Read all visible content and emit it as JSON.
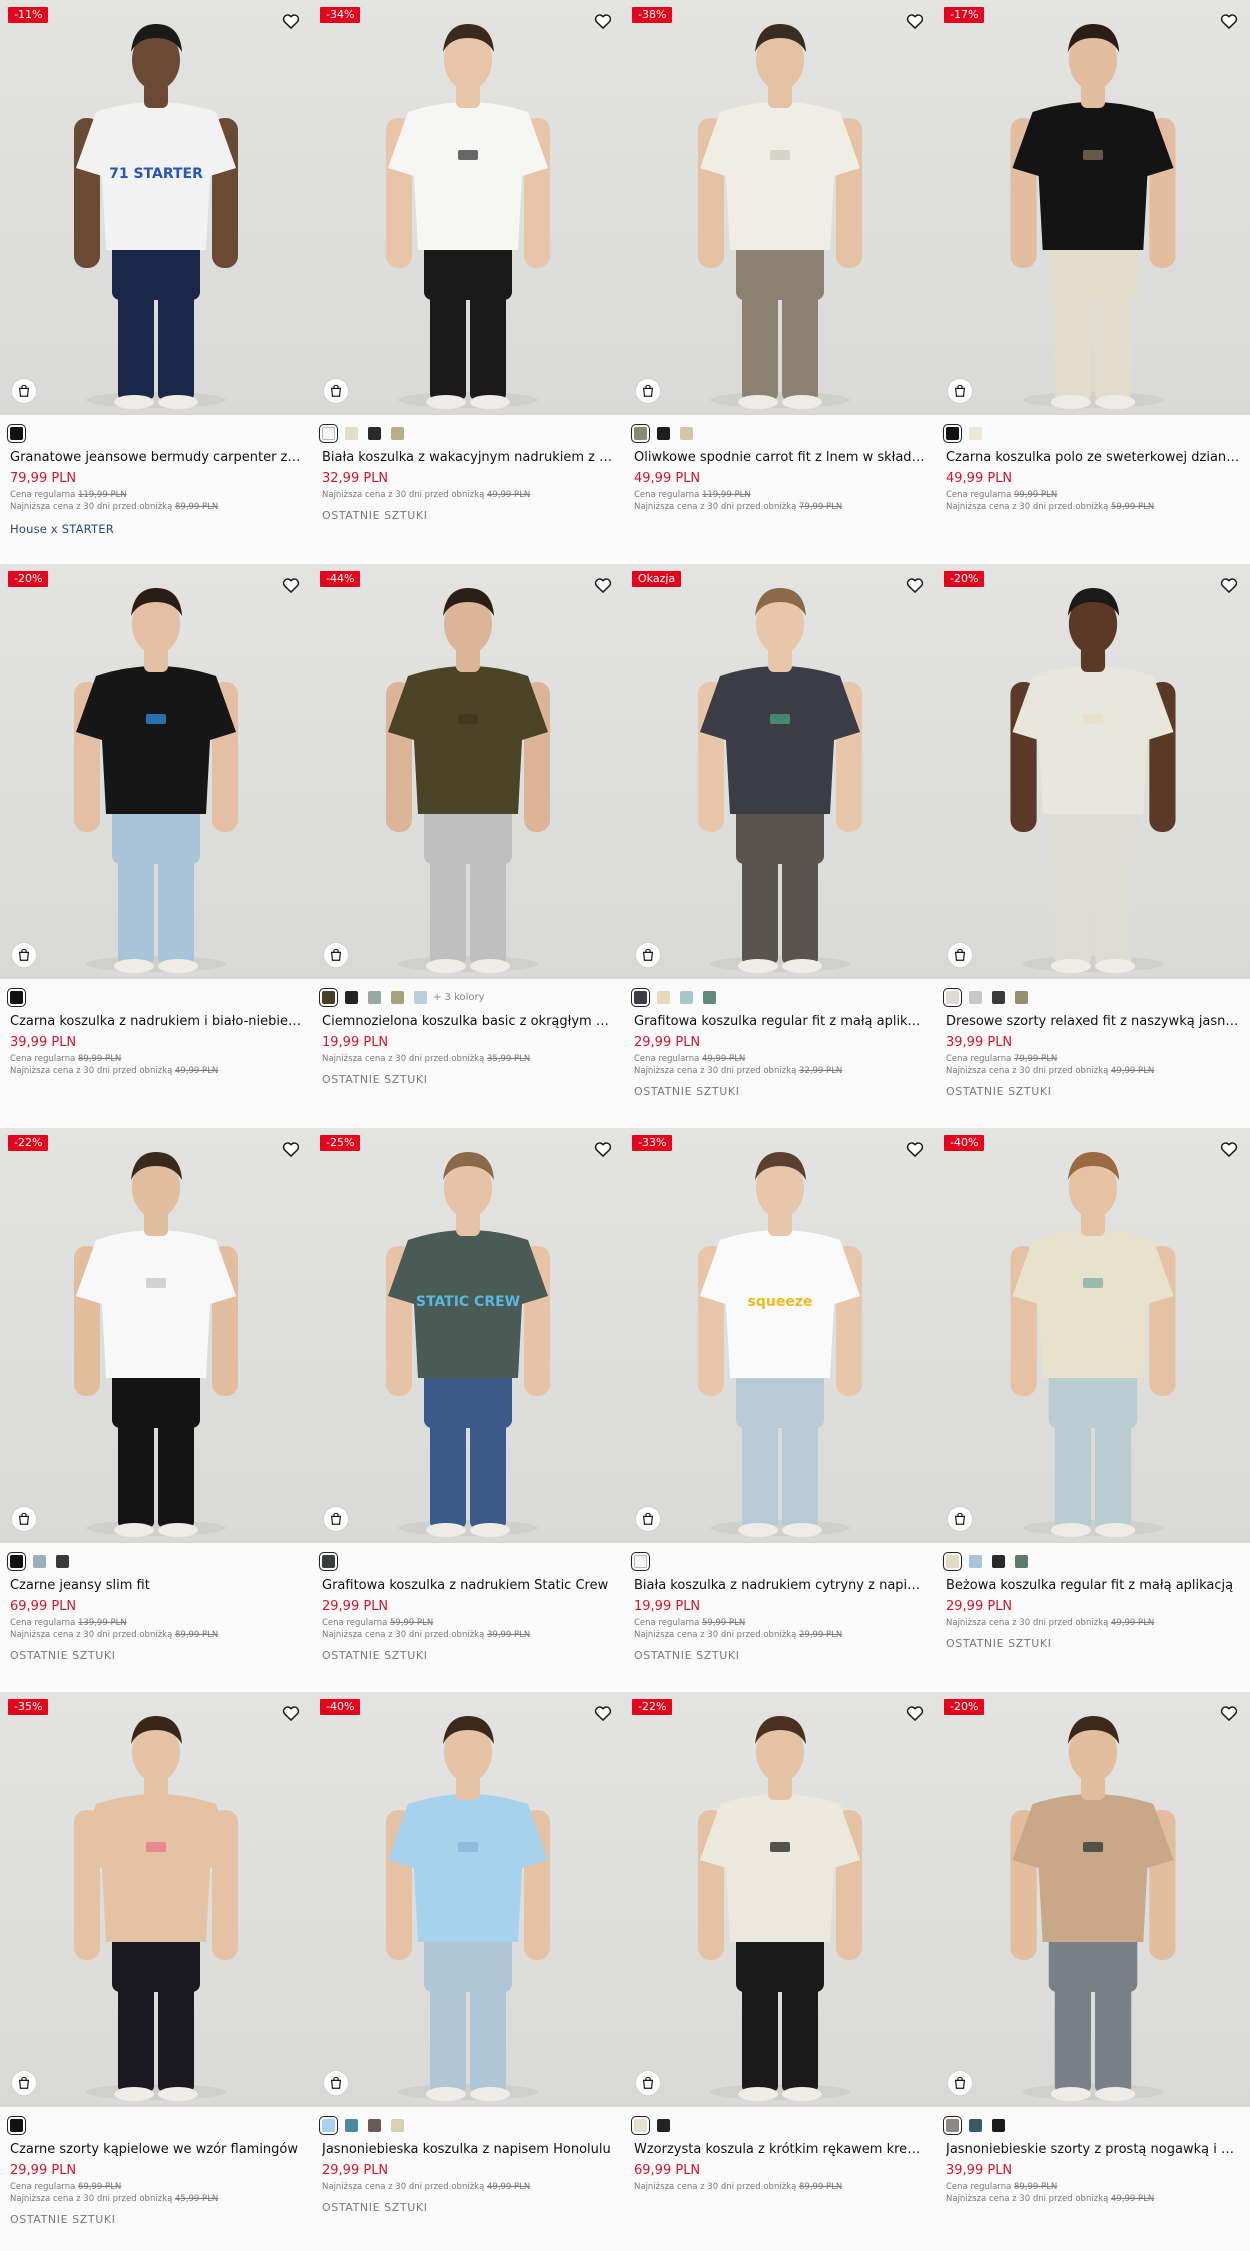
{
  "ui": {
    "regular_label": "Cena regularna",
    "lowest_label": "Najniższa cena z 30 dni przed obniżką",
    "currency_colors": {
      "price": "#d8142b",
      "badge": "#e3051b"
    }
  },
  "products": [
    {
      "badge": "-11%",
      "name": "Granatowe jeansowe bermudy carpenter z h…",
      "price": "79,99 PLN",
      "regular": "119,99 PLN",
      "lowest": "89,99 PLN",
      "tag": "",
      "collab": "House x STARTER",
      "swatches": [
        "#111111"
      ],
      "more": "",
      "look": {
        "top": "#f2f2f2",
        "bottom": "#1b2748",
        "skin": "#6b4a33",
        "hair": "#1a1a1a",
        "accent": "#2b55b5",
        "print": "71 STARTER"
      }
    },
    {
      "badge": "-34%",
      "name": "Biała koszulka z wakacyjnym nadrukiem z pr…",
      "price": "32,99 PLN",
      "regular": "",
      "lowest": "49,99 PLN",
      "tag": "OSTATNIE SZTUKI",
      "collab": "",
      "swatches": [
        "#f4f4f4",
        "#e2dcc8",
        "#2a2a2a",
        "#b5b08a"
      ],
      "more": "",
      "look": {
        "top": "#f6f6f4",
        "bottom": "#1a1a1a",
        "skin": "#e8c4a8",
        "hair": "#3a2a1e",
        "accent": "#444444",
        "print": ""
      }
    },
    {
      "badge": "-38%",
      "name": "Oliwkowe spodnie carrot fit z lnem w składz…",
      "price": "49,99 PLN",
      "regular": "119,99 PLN",
      "lowest": "79,99 PLN",
      "tag": "",
      "collab": "",
      "swatches": [
        "#8a8a72",
        "#1e1e1e",
        "#d2c8a8"
      ],
      "more": "",
      "look": {
        "top": "#f0eee4",
        "bottom": "#8d8172",
        "skin": "#e6c2a4",
        "hair": "#3b2c22",
        "accent": "#d0ccc0",
        "print": ""
      }
    },
    {
      "badge": "-17%",
      "name": "Czarna koszulka polo ze sweterkowej dzianiny",
      "price": "49,99 PLN",
      "regular": "99,99 PLN",
      "lowest": "59,99 PLN",
      "tag": "",
      "collab": "",
      "swatches": [
        "#111111",
        "#ece8d8"
      ],
      "more": "",
      "look": {
        "top": "#141414",
        "bottom": "#e4dccb",
        "skin": "#e2bda0",
        "hair": "#2b1e16",
        "accent": "#7a6a55",
        "print": ""
      }
    },
    {
      "badge": "-20%",
      "name": "Czarna koszulka z nadrukiem i biało-niebiesk…",
      "price": "39,99 PLN",
      "regular": "89,99 PLN",
      "lowest": "49,99 PLN",
      "tag": "",
      "collab": "",
      "swatches": [
        "#111111"
      ],
      "more": "",
      "look": {
        "top": "#161616",
        "bottom": "#a9c3d8",
        "skin": "#e4bfa3",
        "hair": "#2a1d15",
        "accent": "#2a8ad6",
        "print": ""
      }
    },
    {
      "badge": "-44%",
      "name": "Ciemnozielona koszulka basic z okrągłym de…",
      "price": "19,99 PLN",
      "regular": "",
      "lowest": "35,99 PLN",
      "tag": "OSTATNIE SZTUKI",
      "collab": "",
      "swatches": [
        "#4a3e24",
        "#222222",
        "#9aa8a4",
        "#a8a27c",
        "#b8cfe0"
      ],
      "more": "+ 3 kolory",
      "look": {
        "top": "#4b4326",
        "bottom": "#bfbfbf",
        "skin": "#dcb497",
        "hair": "#2a1f17",
        "accent": "#3f3820",
        "print": ""
      }
    },
    {
      "badge": "Okazja",
      "name": "Grafitowa koszulka regular fit z małą aplikacją",
      "price": "29,99 PLN",
      "regular": "49,99 PLN",
      "lowest": "32,99 PLN",
      "tag": "OSTATNIE SZTUKI",
      "collab": "",
      "swatches": [
        "#3c3c44",
        "#e8d8bc",
        "#a8c6cc",
        "#5d8a7a"
      ],
      "more": "",
      "look": {
        "top": "#3b3c45",
        "bottom": "#5a5450",
        "skin": "#e8c6aa",
        "hair": "#8a6a48",
        "accent": "#4a9a7a",
        "print": ""
      }
    },
    {
      "badge": "-20%",
      "name": "Dresowe szorty relaxed fit z naszywką jasnos…",
      "price": "39,99 PLN",
      "regular": "79,99 PLN",
      "lowest": "49,99 PLN",
      "tag": "OSTATNIE SZTUKI",
      "collab": "",
      "swatches": [
        "#dcdcd0",
        "#c8c8c8",
        "#3a3a3a",
        "#9a8c70"
      ],
      "more": "",
      "look": {
        "top": "#e6e6dc",
        "bottom": "#dcdcd4",
        "skin": "#5a3a26",
        "hair": "#1a1a1a",
        "accent": "#e8e0c4",
        "print": ""
      }
    },
    {
      "badge": "-22%",
      "name": "Czarne jeansy slim fit",
      "price": "69,99 PLN",
      "regular": "139,99 PLN",
      "lowest": "89,99 PLN",
      "tag": "OSTATNIE SZTUKI",
      "collab": "",
      "swatches": [
        "#111111",
        "#9ab0b8",
        "#3a3a3a"
      ],
      "more": "",
      "look": {
        "top": "#f8f8f8",
        "bottom": "#141414",
        "skin": "#e2bd9e",
        "hair": "#3a2a1e",
        "accent": "#c8c8c8",
        "print": ""
      }
    },
    {
      "badge": "-25%",
      "name": "Grafitowa koszulka z nadrukiem Static Crew",
      "price": "29,99 PLN",
      "regular": "59,99 PLN",
      "lowest": "39,99 PLN",
      "tag": "OSTATNIE SZTUKI",
      "collab": "",
      "swatches": [
        "#3a3f3c"
      ],
      "more": "",
      "look": {
        "top": "#4a5a54",
        "bottom": "#3b5a8a",
        "skin": "#e6c3a6",
        "hair": "#8a6a4a",
        "accent": "#5ab8e0",
        "print": "STATIC CREW"
      }
    },
    {
      "badge": "-33%",
      "name": "Biała koszulka z nadrukiem cytryny z napise…",
      "price": "19,99 PLN",
      "regular": "59,99 PLN",
      "lowest": "29,99 PLN",
      "tag": "OSTATNIE SZTUKI",
      "collab": "",
      "swatches": [
        "#f4f4f4"
      ],
      "more": "",
      "look": {
        "top": "#fafafa",
        "bottom": "#b8cad6",
        "skin": "#e8c6aa",
        "hair": "#5a4030",
        "accent": "#f2b81e",
        "print": "squeeze"
      }
    },
    {
      "badge": "-40%",
      "name": "Beżowa koszulka regular fit z małą aplikacją",
      "price": "29,99 PLN",
      "regular": "",
      "lowest": "49,99 PLN",
      "tag": "OSTATNIE SZTUKI",
      "collab": "",
      "swatches": [
        "#e4dcc0",
        "#a8c4d8",
        "#2a2a2a",
        "#5a7a6a"
      ],
      "more": "",
      "look": {
        "top": "#e8e2cc",
        "bottom": "#b9ccd2",
        "skin": "#e6c2a4",
        "hair": "#9a6a40",
        "accent": "#88b0a8",
        "print": ""
      }
    },
    {
      "badge": "-35%",
      "name": "Czarne szorty kąpielowe we wzór flamingów",
      "price": "29,99 PLN",
      "regular": "69,99 PLN",
      "lowest": "45,99 PLN",
      "tag": "OSTATNIE SZTUKI",
      "collab": "",
      "swatches": [
        "#111111"
      ],
      "more": "",
      "look": {
        "top": "#e6c2a4",
        "bottom": "#1a1820",
        "skin": "#e6c2a4",
        "hair": "#3a2618",
        "accent": "#e87a8a",
        "print": ""
      }
    },
    {
      "badge": "-40%",
      "name": "Jasnoniebieska koszulka z napisem Honolulu",
      "price": "29,99 PLN",
      "regular": "",
      "lowest": "49,99 PLN",
      "tag": "OSTATNIE SZTUKI",
      "collab": "",
      "swatches": [
        "#a8d0ec",
        "#4a8a9a",
        "#6a5a5a",
        "#d8d0b0"
      ],
      "more": "",
      "look": {
        "top": "#a6d2ee",
        "bottom": "#aec6d6",
        "skin": "#e6c2a4",
        "hair": "#3a2a1e",
        "accent": "#8ab8d8",
        "print": ""
      }
    },
    {
      "badge": "-22%",
      "name": "Wzorzysta koszula z krótkim rękawem krem…",
      "price": "69,99 PLN",
      "regular": "",
      "lowest": "89,99 PLN",
      "tag": "",
      "collab": "",
      "swatches": [
        "#e4e0d4",
        "#222222"
      ],
      "more": "",
      "look": {
        "top": "#ece8dc",
        "bottom": "#1a1a1a",
        "skin": "#e6c2a4",
        "hair": "#4a3020",
        "accent": "#2a2a2a",
        "print": ""
      }
    },
    {
      "badge": "-20%",
      "name": "Jasnoniebieskie szorty z prostą nogawką i ki…",
      "price": "39,99 PLN",
      "regular": "89,99 PLN",
      "lowest": "49,99 PLN",
      "tag": "",
      "collab": "",
      "swatches": [
        "#8a8a80",
        "#3a5a6a",
        "#1a1a1a"
      ],
      "more": "",
      "look": {
        "top": "#c8a888",
        "bottom": "#7a8088",
        "skin": "#e2bd9e",
        "hair": "#3a2a1e",
        "accent": "#3a3a3a",
        "print": ""
      }
    }
  ]
}
